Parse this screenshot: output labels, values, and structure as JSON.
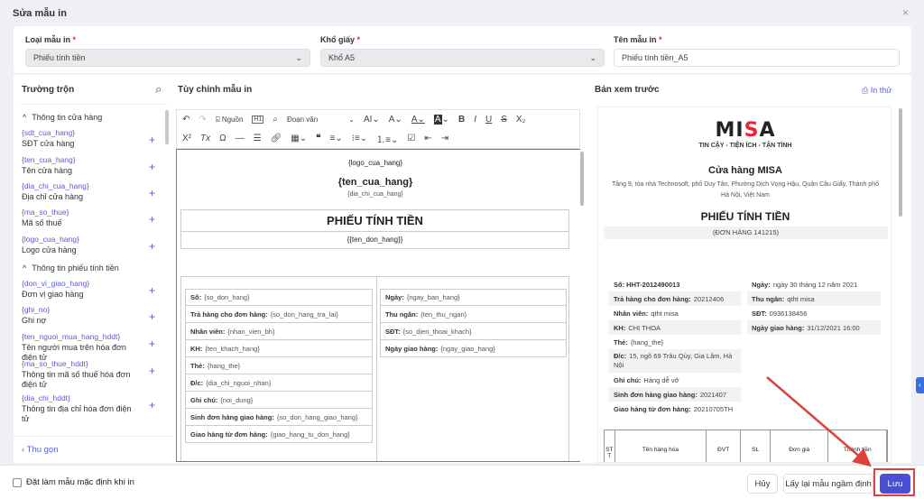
{
  "dialog": {
    "title": "Sửa mẫu in",
    "close": "×"
  },
  "form": {
    "print_type": {
      "label": "Loại mẫu in",
      "value": "Phiếu tính tiền"
    },
    "paper": {
      "label": "Khổ giấy",
      "value": "Khổ A5"
    },
    "name": {
      "label": "Tên mẫu in",
      "value": "Phiếu tính tiền_A5"
    },
    "required": "*"
  },
  "merge_fields": {
    "title": "Trường trộn",
    "groups": [
      {
        "label": "Thông tin cửa hàng",
        "fields": [
          {
            "code": "{sdt_cua_hang}",
            "name": "SĐT cửa hàng"
          },
          {
            "code": "{ten_cua_hang}",
            "name": "Tên cửa hàng"
          },
          {
            "code": "{dia_chi_cua_hang}",
            "name": "Địa chỉ cửa hàng"
          },
          {
            "code": "{ma_so_thue}",
            "name": "Mã số thuế"
          },
          {
            "code": "{logo_cua_hang}",
            "name": "Logo cửa hàng"
          }
        ]
      },
      {
        "label": "Thông tin phiếu tính tiền",
        "fields": [
          {
            "code": "{don_vi_giao_hang}",
            "name": "Đơn vị giao hàng"
          },
          {
            "code": "{ghi_no}",
            "name": "Ghi nợ"
          },
          {
            "code": "{ten_nguoi_mua_hang_hddt}",
            "name": "Tên người mua trên hóa đơn điện tử"
          },
          {
            "code": "{ma_so_thue_hddt}",
            "name": "Thông tin mã số thuế hóa đơn điện tử"
          },
          {
            "code": "{dia_chi_hddt}",
            "name": "Thông tin địa chỉ hóa đơn điện tử"
          }
        ]
      }
    ],
    "collapse": "Thu gọn"
  },
  "editor": {
    "title": "Tùy chỉnh mẫu in",
    "toolbar": {
      "source": "Nguồn",
      "format": "Đoạn văn"
    },
    "logo": "{logo_cua_hang}",
    "store_name": "{ten_cua_hang}",
    "store_address": "{dia_chi_cua_hang}",
    "doc_title": "PHIẾU TÍNH TIỀN",
    "order_name": "{{ten_don_hang}}",
    "left_rows": [
      {
        "label": "Số:",
        "value": "{so_don_hang}"
      },
      {
        "label": "Trả hàng cho đơn hàng:",
        "value": "{so_don_hang_tra_lai}"
      },
      {
        "label": "Nhân viên:",
        "value": "{nhan_vien_bh}"
      },
      {
        "label": "KH:",
        "value": "{ten_khach_hang}"
      },
      {
        "label": "Thẻ:",
        "value": "{hang_the}"
      },
      {
        "label": "Đ/c:",
        "value": "{dia_chi_nguoi_nhan}"
      },
      {
        "label": "Ghi chú:",
        "value": "{noi_dung}"
      },
      {
        "label": "Sinh đơn hàng giao hàng:",
        "value": "{so_don_hang_giao_hang}"
      },
      {
        "label": "Giao hàng từ đơn hàng:",
        "value": "{giao_hang_tu_don_hang}"
      }
    ],
    "right_rows": [
      {
        "label": "Ngày:",
        "value": "{ngay_ban_hang}"
      },
      {
        "label": "Thu ngân:",
        "value": "{ten_thu_ngan}"
      },
      {
        "label": "SĐT:",
        "value": "{so_dien_thoai_khach}"
      },
      {
        "label": "Ngày giao hàng:",
        "value": "{ngay_giao_hang}"
      }
    ]
  },
  "preview": {
    "title": "Bản xem trước",
    "print_test": "In thử",
    "logo_text": "MISA",
    "logo_slogan": "TIN CẬY - TIỆN ÍCH - TẬN TÌNH",
    "store_name": "Cửa hàng MISA",
    "store_address": "Tầng 9, tòa nhà Technosoft, phố Duy Tân, Phường Dịch Vọng Hậu, Quận Cầu Giấy, Thành phố Hà Nội, Việt Nam",
    "doc_title": "PHIẾU TÍNH TIỀN",
    "order": "(ĐƠN HÀNG 141215)",
    "left_rows": [
      {
        "label": "Số: HHT-2012490013",
        "value": ""
      },
      {
        "label": "Trả hàng cho đơn hàng:",
        "value": "20212406"
      },
      {
        "label": "Nhân viên:",
        "value": "qtht misa"
      },
      {
        "label": "KH:",
        "value": "CHỊ THOA"
      },
      {
        "label": "Thẻ:",
        "value": "{hang_the}"
      },
      {
        "label": "Đ/c:",
        "value": "15, ngõ 69 Trâu Qùy, Gia Lâm, Hà Nội"
      },
      {
        "label": "Ghi chú:",
        "value": "Hàng dễ vỡ"
      },
      {
        "label": "Sinh đơn hàng giao hàng:",
        "value": "2021407"
      },
      {
        "label": "Giao hàng từ đơn hàng:",
        "value": "20210705TH"
      }
    ],
    "right_rows": [
      {
        "label": "Ngày:",
        "value": "ngày 30 tháng 12 năm 2021"
      },
      {
        "label": "Thu ngân:",
        "value": "qtht misa"
      },
      {
        "label": "SĐT:",
        "value": "0936138456"
      },
      {
        "label": "Ngày giao hàng:",
        "value": "31/12/2021 16:00"
      }
    ],
    "table_headers": [
      "STT",
      "Tên hàng hóa",
      "ĐVT",
      "SL",
      "Đơn giá",
      "Thành tiền"
    ]
  },
  "footer": {
    "default_checkbox": "Đặt làm mẫu mặc định khi in",
    "cancel": "Hủy",
    "reset": "Lấy lại mẫu ngầm định",
    "save": "Lưu"
  },
  "colors": {
    "accent": "#4b4fd6",
    "annotation": "#e0403a"
  }
}
